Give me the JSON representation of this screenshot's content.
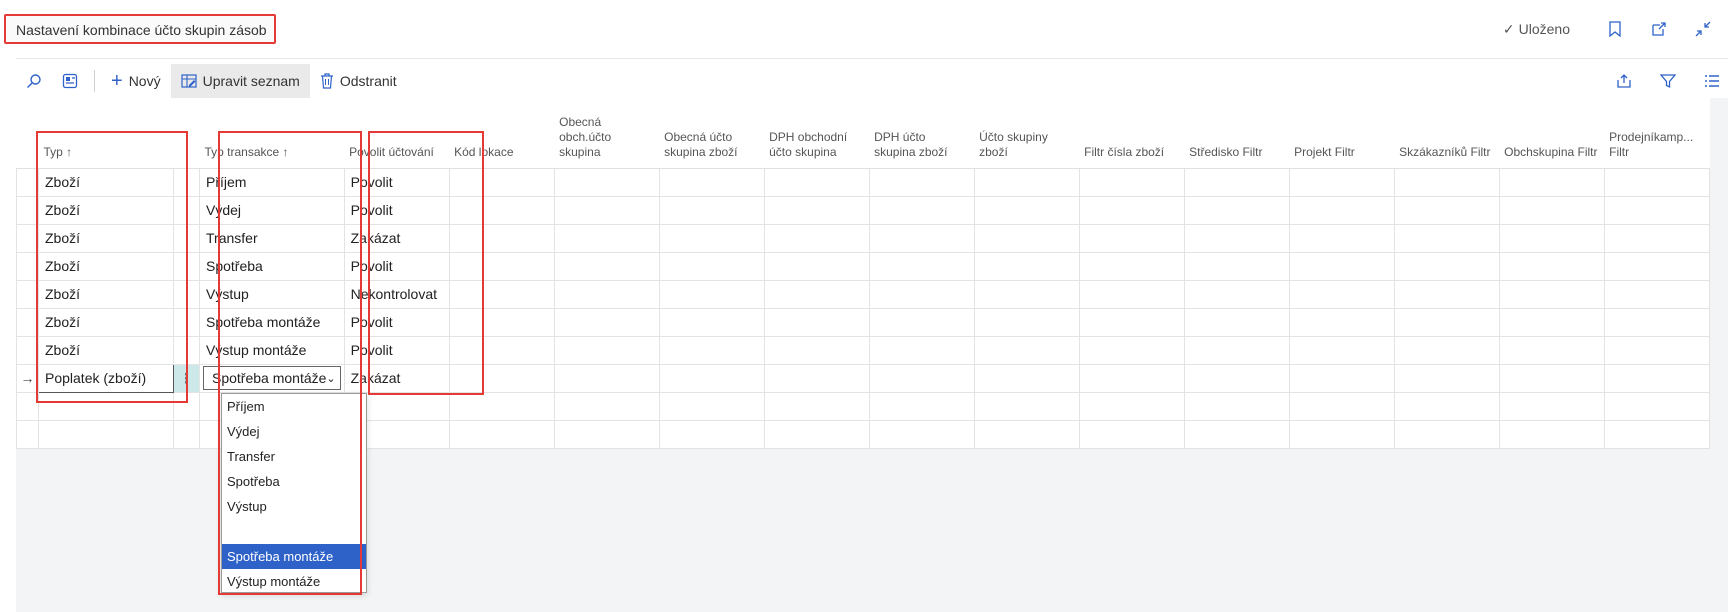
{
  "page": {
    "title": "Nastavení kombinace účto skupin zásob",
    "saved_label": "Uloženo"
  },
  "toolbar": {
    "new_label": "Nový",
    "edit_list_label": "Upravit seznam",
    "delete_label": "Odstranit"
  },
  "columns": [
    "Typ ↑",
    "Typ transakce ↑",
    "Povolit účtování",
    "Kód lokace",
    "Obecná obch.účto skupina",
    "Obecná účto skupina zboží",
    "DPH obchodní účto skupina",
    "DPH účto skupina zboží",
    "Účto skupiny zboží",
    "Filtr čísla zboží",
    "Středisko Filtr",
    "Projekt Filtr",
    "Skzákazníků Filtr",
    "Obchskupina Filtr",
    "Prodejníkamp... Filtr"
  ],
  "rows": [
    {
      "typ": "Zboží",
      "typ_transakce": "Příjem",
      "povolit": "Povolit"
    },
    {
      "typ": "Zboží",
      "typ_transakce": "Výdej",
      "povolit": "Povolit"
    },
    {
      "typ": "Zboží",
      "typ_transakce": "Transfer",
      "povolit": "Zakázat"
    },
    {
      "typ": "Zboží",
      "typ_transakce": "Spotřeba",
      "povolit": "Povolit"
    },
    {
      "typ": "Zboží",
      "typ_transakce": "Výstup",
      "povolit": "Nekontrolovat"
    },
    {
      "typ": "Zboží",
      "typ_transakce": "Spotřeba montáže",
      "povolit": "Povolit"
    },
    {
      "typ": "Zboží",
      "typ_transakce": "Výstup montáže",
      "povolit": "Povolit"
    },
    {
      "typ": "Poplatek (zboží)",
      "typ_transakce": "Spotřeba montáže",
      "povolit": "Zakázat"
    }
  ],
  "dropdown": {
    "options": [
      "Příjem",
      "Výdej",
      "Transfer",
      "Spotřeba",
      "Výstup",
      "",
      "Spotřeba montáže",
      "Výstup montáže"
    ],
    "selected": "Spotřeba montáže"
  },
  "colors": {
    "highlight": "#e53935",
    "selected_option": "#2f62c9",
    "row_action": "#cde8e8"
  }
}
